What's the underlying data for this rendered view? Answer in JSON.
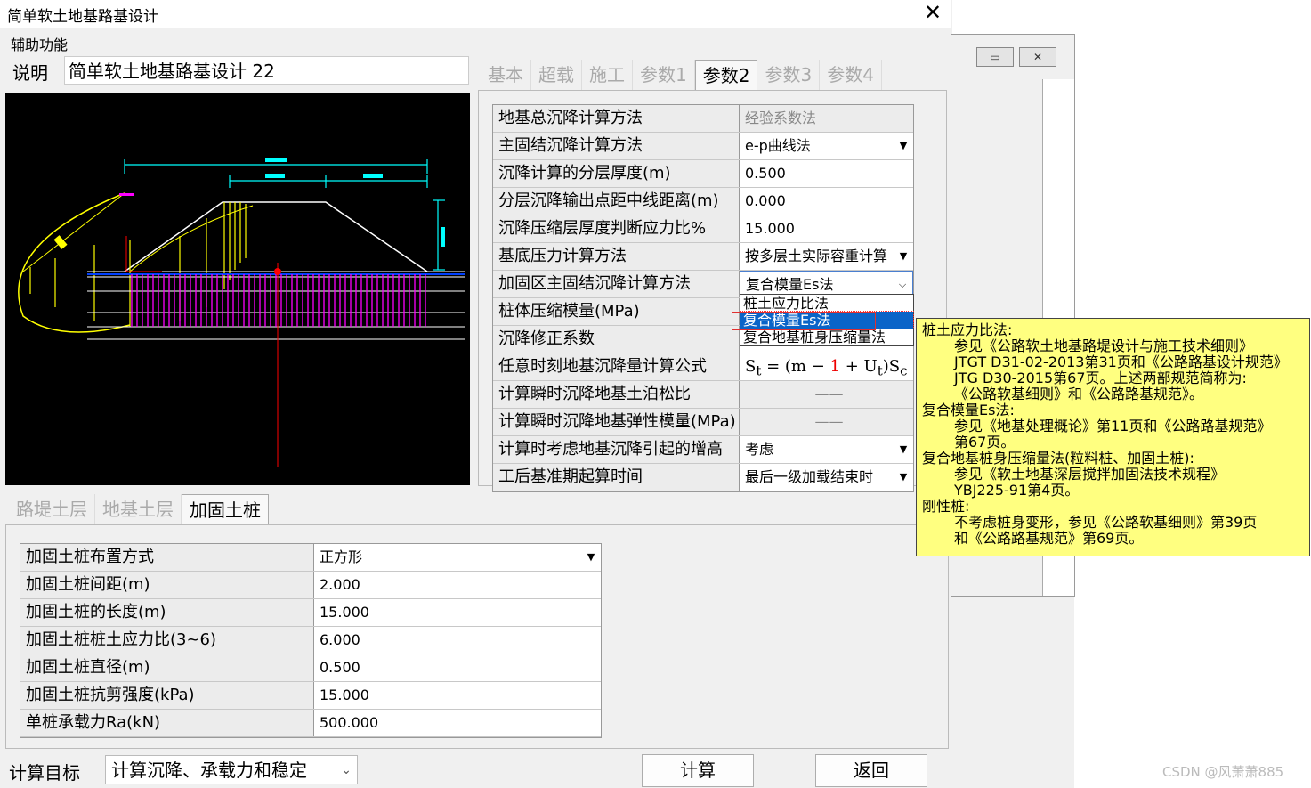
{
  "window": {
    "title": "简单软土地基路基设计",
    "close": "✕"
  },
  "menu": {
    "aux": "辅助功能"
  },
  "desc": {
    "label": "说明",
    "value": "简单软土地基路基设计  22"
  },
  "top_tabs": [
    "基本",
    "超载",
    "施工",
    "参数1",
    "参数2",
    "参数3",
    "参数4"
  ],
  "top_active_tab": "参数2",
  "top_grid": [
    {
      "label": "地基总沉降计算方法",
      "value": "经验系数法",
      "readonly": true,
      "dropdown": false
    },
    {
      "label": "主固结沉降计算方法",
      "value": "e-p曲线法",
      "readonly": false,
      "dropdown": true
    },
    {
      "label": "沉降计算的分层厚度(m)",
      "value": "0.500",
      "readonly": false,
      "dropdown": false
    },
    {
      "label": "分层沉降输出点距中线距离(m)",
      "value": "0.000",
      "readonly": false,
      "dropdown": false
    },
    {
      "label": "沉降压缩层厚度判断应力比%",
      "value": "15.000",
      "readonly": false,
      "dropdown": false
    },
    {
      "label": "基底压力计算方法",
      "value": "按多层土实际容重计算",
      "readonly": false,
      "dropdown": true
    },
    {
      "label": "加固区主固结沉降计算方法",
      "value": "复合模量Es法",
      "readonly": false,
      "dropdown": true
    },
    {
      "label": "桩体压缩模量(MPa)",
      "value": "",
      "readonly": false,
      "dropdown": false
    },
    {
      "label": "沉降修正系数",
      "value": "",
      "readonly": false,
      "dropdown": false
    },
    {
      "label": "任意时刻地基沉降量计算公式",
      "value": "",
      "readonly": false,
      "dropdown": false
    },
    {
      "label": "计算瞬时沉降地基土泊松比",
      "value": "——",
      "readonly": true,
      "dropdown": false
    },
    {
      "label": "计算瞬时沉降地基弹性模量(MPa)",
      "value": "——",
      "readonly": true,
      "dropdown": false
    },
    {
      "label": "计算时考虑地基沉降引起的增高",
      "value": "考虑",
      "readonly": false,
      "dropdown": true
    },
    {
      "label": "工后基准期起算时间",
      "value": "最后一级加载结束时",
      "readonly": false,
      "dropdown": true
    }
  ],
  "formula": {
    "s": "S",
    "t": "t",
    "eq": " = (m − ",
    "one": "1",
    "plus": " + U",
    "c": "c",
    "close": ")S"
  },
  "dropdown_options": [
    "桩土应力比法",
    "复合模量Es法",
    "复合地基桩身压缩量法"
  ],
  "dropdown_selected": "复合模量Es法",
  "tooltip": [
    {
      "text": "桩土应力比法:",
      "indent": false
    },
    {
      "text": "参见《公路软土地基路堤设计与施工技术细则》",
      "indent": true
    },
    {
      "text": "JTGT D31-02-2013第31页和《公路路基设计规范》",
      "indent": true
    },
    {
      "text": "JTG D30-2015第67页。上述两部规范简称为:",
      "indent": true
    },
    {
      "text": "《公路软基细则》和《公路路基规范》。",
      "indent": true
    },
    {
      "text": "复合模量Es法:",
      "indent": false
    },
    {
      "text": "参见《地基处理概论》第11页和《公路路基规范》",
      "indent": true
    },
    {
      "text": "第67页。",
      "indent": true
    },
    {
      "text": "复合地基桩身压缩量法(粒料桩、加固土桩):",
      "indent": false
    },
    {
      "text": "参见《软土地基深层搅拌加固法技术规程》",
      "indent": true
    },
    {
      "text": "YBJ225-91第4页。",
      "indent": true
    },
    {
      "text": "刚性桩:",
      "indent": false
    },
    {
      "text": "不考虑桩身变形，参见《公路软基细则》第39页",
      "indent": true
    },
    {
      "text": "和《公路路基规范》第69页。",
      "indent": true
    }
  ],
  "bottom_tabs": [
    "路堤土层",
    "地基土层",
    "加固土桩"
  ],
  "bottom_active_tab": "加固土桩",
  "bottom_grid": [
    {
      "label": "加固土桩布置方式",
      "value": "正方形",
      "dropdown": true
    },
    {
      "label": "加固土桩间距(m)",
      "value": "2.000",
      "dropdown": false
    },
    {
      "label": "加固土桩的长度(m)",
      "value": "15.000",
      "dropdown": false
    },
    {
      "label": "加固土桩桩土应力比(3~6)",
      "value": "6.000",
      "dropdown": false
    },
    {
      "label": "加固土桩直径(m)",
      "value": "0.500",
      "dropdown": false
    },
    {
      "label": "加固土桩抗剪强度(kPa)",
      "value": "15.000",
      "dropdown": false
    },
    {
      "label": "单桩承载力Ra(kN)",
      "value": "500.000",
      "dropdown": false
    }
  ],
  "footer": {
    "target_label": "计算目标",
    "target_value": "计算沉降、承载力和稳定",
    "calc": "计算",
    "back": "返回"
  },
  "watermark": "CSDN @风萧萧885",
  "bg_window": {
    "btn_restore": "▭",
    "btn_close": "✕"
  }
}
